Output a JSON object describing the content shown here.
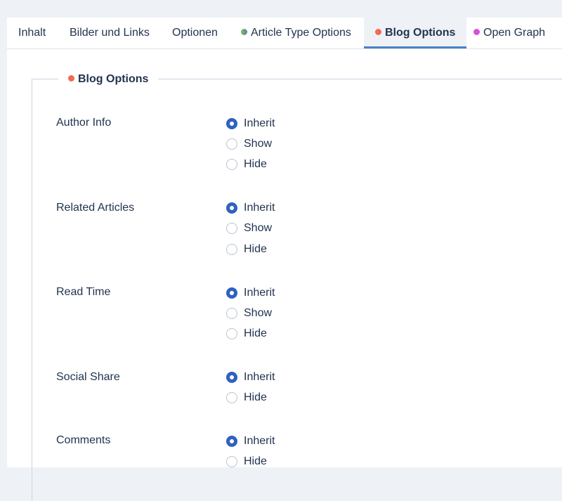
{
  "tabs": [
    {
      "label": "Inhalt"
    },
    {
      "label": "Bilder und Links"
    },
    {
      "label": "Optionen"
    },
    {
      "label": "Article Type Options",
      "dot_color": "#8fbf3a",
      "dot_color2": "#4a80c8"
    },
    {
      "label": "Blog Options",
      "dot_color": "#f26b4f",
      "active": true
    },
    {
      "label": "Open Graph",
      "dot_color": "#d94fd8"
    }
  ],
  "fieldset": {
    "legend": "Blog Options",
    "legend_dot_color": "#f26b4f"
  },
  "fields": [
    {
      "label": "Author Info",
      "options": [
        "Inherit",
        "Show",
        "Hide"
      ],
      "selected": "Inherit"
    },
    {
      "label": "Related Articles",
      "options": [
        "Inherit",
        "Show",
        "Hide"
      ],
      "selected": "Inherit"
    },
    {
      "label": "Read Time",
      "options": [
        "Inherit",
        "Show",
        "Hide"
      ],
      "selected": "Inherit"
    },
    {
      "label": "Social Share",
      "options": [
        "Inherit",
        "Hide"
      ],
      "selected": "Inherit"
    },
    {
      "label": "Comments",
      "options": [
        "Inherit",
        "Hide"
      ],
      "selected": "Inherit"
    }
  ],
  "colors": {
    "accent": "#2e62c0",
    "tab_underline": "#4a80c8",
    "text": "#22344f",
    "background": "#eef2f6"
  }
}
